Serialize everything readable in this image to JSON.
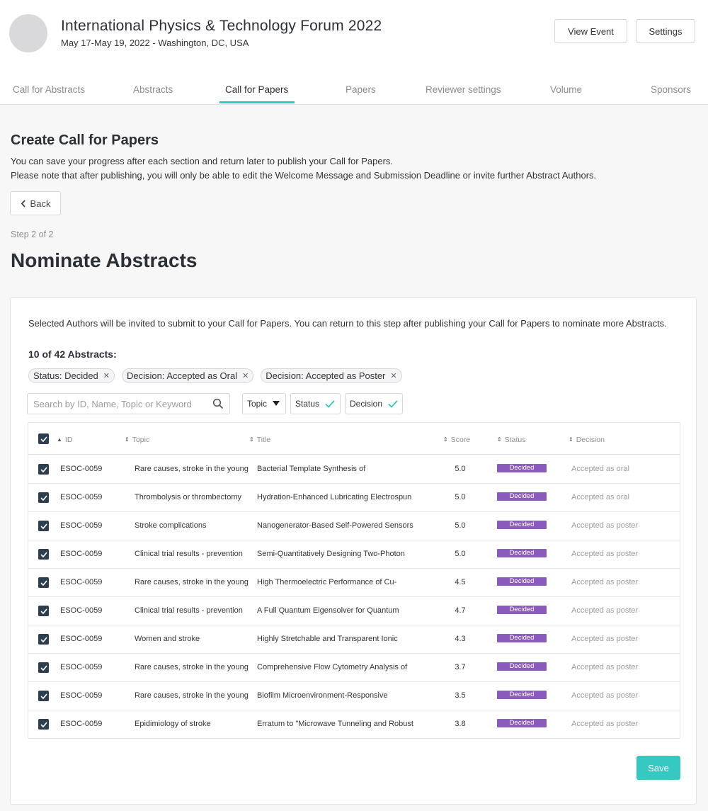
{
  "header": {
    "title": "International Physics & Technology Forum 2022",
    "subtitle": "May 17-May 19, 2022 - Washington, DC, USA",
    "view_event_label": "View Event",
    "settings_label": "Settings"
  },
  "tabs": [
    {
      "label": "Call for Abstracts"
    },
    {
      "label": "Abstracts"
    },
    {
      "label": "Call for Papers"
    },
    {
      "label": "Papers"
    },
    {
      "label": "Reviewer settings"
    },
    {
      "label": "Volume"
    },
    {
      "label": "Sponsors"
    }
  ],
  "page": {
    "title": "Create Call for Papers",
    "note_line1": "You can save your progress after each section and return later to publish your Call for Papers.",
    "note_line2": "Please note that after publishing, you will only be able to edit the Welcome Message and Submission Deadline or invite further Abstract Authors.",
    "back_label": "Back",
    "step": "Step 2 of 2",
    "section_title": "Nominate Abstracts"
  },
  "card": {
    "description": "Selected Authors will be invited to submit to your Call for Papers. You can return to this step after publishing your Call for Papers to nominate more Abstracts.",
    "count": "10 of 42 Abstracts:",
    "chips": [
      {
        "label": "Status: Decided"
      },
      {
        "label": "Decision: Accepted as Oral"
      },
      {
        "label": "Decision: Accepted as Poster"
      }
    ],
    "search_placeholder": "Search by ID, Name, Topic or Keyword",
    "filters": {
      "topic": "Topic",
      "status": "Status",
      "decision": "Decision"
    },
    "save_label": "Save"
  },
  "table": {
    "headers": {
      "id": "ID",
      "topic": "Topic",
      "title": "Title",
      "score": "Score",
      "status": "Status",
      "decision": "Decision"
    },
    "rows": [
      {
        "id": "ESOC-0059",
        "topic": "Rare causes, stroke in the young",
        "title": "Bacterial Template Synthesis of",
        "score": "5.0",
        "status": "Decided",
        "decision": "Accepted as oral"
      },
      {
        "id": "ESOC-0059",
        "topic": "Thrombolysis or thrombectomy",
        "title": "Hydration-Enhanced Lubricating Electrospun",
        "score": "5.0",
        "status": "Decided",
        "decision": "Accepted as oral"
      },
      {
        "id": "ESOC-0059",
        "topic": "Stroke complications",
        "title": "Nanogenerator-Based Self-Powered Sensors",
        "score": "5.0",
        "status": "Decided",
        "decision": "Accepted as poster"
      },
      {
        "id": "ESOC-0059",
        "topic": "Clinical trial results - prevention",
        "title": "Semi-Quantitatively Designing Two-Photon",
        "score": "5.0",
        "status": "Decided",
        "decision": "Accepted as poster"
      },
      {
        "id": "ESOC-0059",
        "topic": "Rare causes, stroke in the young",
        "title": "High Thermoelectric Performance of Cu-",
        "score": "4.5",
        "status": "Decided",
        "decision": "Accepted as poster"
      },
      {
        "id": "ESOC-0059",
        "topic": "Clinical trial results - prevention",
        "title": "A Full Quantum Eigensolver for Quantum",
        "score": "4.7",
        "status": "Decided",
        "decision": "Accepted as poster"
      },
      {
        "id": "ESOC-0059",
        "topic": "Women and stroke",
        "title": "Highly Stretchable and Transparent Ionic",
        "score": "4.3",
        "status": "Decided",
        "decision": "Accepted as poster"
      },
      {
        "id": "ESOC-0059",
        "topic": "Rare causes, stroke in the young",
        "title": "Comprehensive Flow Cytometry Analysis of",
        "score": "3.7",
        "status": "Decided",
        "decision": "Accepted as poster"
      },
      {
        "id": "ESOC-0059",
        "topic": "Rare causes, stroke in the young",
        "title": "Biofilm Microenvironment-Responsive",
        "score": "3.5",
        "status": "Decided",
        "decision": "Accepted as poster"
      },
      {
        "id": "ESOC-0059",
        "topic": "Epidimiology of stroke",
        "title": "Erratum to \"Microwave Tunneling and Robust",
        "score": "3.8",
        "status": "Decided",
        "decision": "Accepted as poster"
      }
    ]
  },
  "colors": {
    "accent": "#2fc6c0",
    "status_badge": "#8a5bbd",
    "checkbox": "#2c3e50"
  },
  "icons": {
    "back": "chevron-left-icon",
    "search": "search-icon",
    "remove_chip": "close-icon",
    "dropdown": "caret-down-icon",
    "checked": "check-icon",
    "sort": "sort-icon"
  }
}
